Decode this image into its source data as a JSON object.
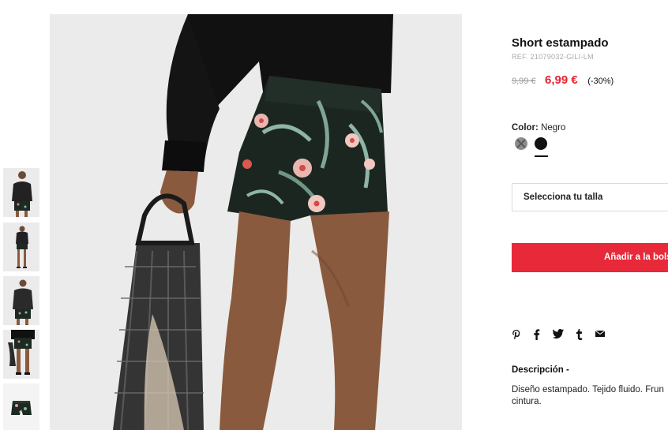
{
  "product": {
    "title": "Short estampado",
    "ref": "REF. 21079032-GILI-LM",
    "old_price": "9,99 €",
    "new_price": "6,99 €",
    "discount": "(-30%)"
  },
  "color": {
    "label": "Color:",
    "value": "Negro",
    "swatches": [
      "unavailable-grey",
      "black"
    ],
    "selected": "black"
  },
  "size_select": {
    "placeholder": "Selecciona tu talla"
  },
  "add_button": {
    "label": "Añadir a la bols"
  },
  "social": {
    "icons": [
      "pinterest-icon",
      "facebook-icon",
      "twitter-icon",
      "tumblr-icon",
      "email-icon"
    ]
  },
  "description": {
    "title": "Descripción -",
    "line1": "Diseño estampado. Tejido fluido. Frun",
    "line2": "cintura."
  },
  "colors": {
    "accent": "#e8293a",
    "price_red": "#e5252f"
  }
}
